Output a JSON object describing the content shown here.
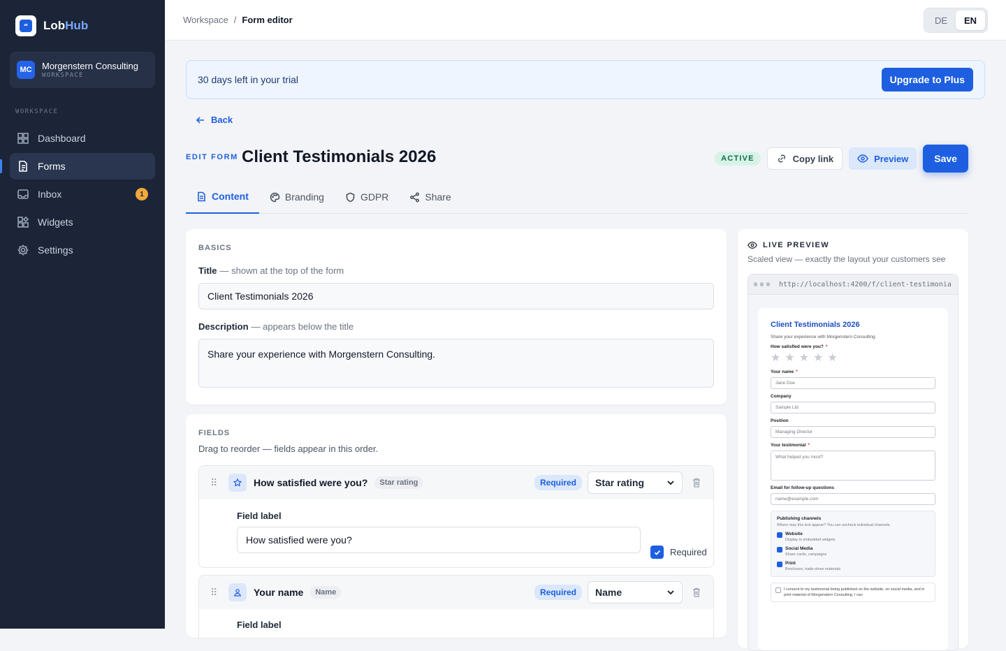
{
  "app": {
    "name_a": "Lob",
    "name_b": "Hub"
  },
  "workspace": {
    "initials": "MC",
    "name": "Morgenstern Consulting",
    "sub": "WORKSPACE"
  },
  "nav": {
    "heading": "WORKSPACE",
    "items": [
      {
        "label": "Dashboard",
        "icon": "grid-icon"
      },
      {
        "label": "Forms",
        "icon": "document-icon",
        "active": true
      },
      {
        "label": "Inbox",
        "icon": "inbox-icon",
        "badge": "1"
      },
      {
        "label": "Widgets",
        "icon": "widgets-icon"
      },
      {
        "label": "Settings",
        "icon": "gear-icon"
      }
    ]
  },
  "breadcrumb": {
    "root": "Workspace",
    "sep": "/",
    "current": "Form editor"
  },
  "lang": {
    "de": "DE",
    "en": "EN",
    "active": "EN"
  },
  "trial": {
    "text": "30 days left in your trial",
    "cta": "Upgrade to Plus"
  },
  "header": {
    "back": "Back",
    "edit_label": "EDIT FORM",
    "title": "Client Testimonials 2026",
    "status": "ACTIVE",
    "copy_link": "Copy link",
    "preview": "Preview",
    "save": "Save"
  },
  "tabs": [
    "Content",
    "Branding",
    "GDPR",
    "Share"
  ],
  "basics": {
    "heading": "BASICS",
    "title_label": "Title",
    "title_hint": "— shown at the top of the form",
    "title_value": "Client Testimonials 2026",
    "desc_label": "Description",
    "desc_hint": "— appears below the title",
    "desc_value": "Share your experience with Morgenstern Consulting."
  },
  "fields": {
    "heading": "FIELDS",
    "sub": "Drag to reorder — fields appear in this order.",
    "items": [
      {
        "name": "How satisfied were you?",
        "type": "Star rating",
        "required": "Required",
        "select": "Star rating",
        "label_title": "Field label",
        "label_value": "How satisfied were you?",
        "req_check": "Required"
      },
      {
        "name": "Your name",
        "type": "Name",
        "required": "Required",
        "select": "Name",
        "label_title": "Field label"
      }
    ]
  },
  "live_preview": {
    "title": "LIVE PREVIEW",
    "sub": "Scaled view — exactly the layout your customers see",
    "url": "http://localhost:4200/f/client-testimonials-2026",
    "form": {
      "title": "Client Testimonials 2026",
      "desc": "Share your experience with Morgenstern Consulting.",
      "q_rating": "How satisfied were you?",
      "name_lbl": "Your name",
      "name_ph": "Jane Doe",
      "company_lbl": "Company",
      "company_ph": "Sample Ltd",
      "position_lbl": "Position",
      "position_ph": "Managing Director",
      "testimonial_lbl": "Your testimonial",
      "testimonial_ph": "What helped you most?",
      "email_lbl": "Email for follow-up questions",
      "email_ph": "name@example.com",
      "channels_title": "Publishing channels",
      "channels_sub": "Where may this text appear? You can uncheck individual channels.",
      "channels": [
        {
          "name": "Website",
          "desc": "Display in embedded widgets"
        },
        {
          "name": "Social Media",
          "desc": "Share cards, campaigns"
        },
        {
          "name": "Print",
          "desc": "Brochures, trade-show materials"
        }
      ],
      "consent": "I consent to my testimonial being published on the website, on social media, and in print material of Morgenstern Consulting. I can"
    }
  },
  "colors": {
    "accent": "#1d5fe0",
    "sidebar": "#1c2537",
    "badge": "#f0a93b"
  }
}
